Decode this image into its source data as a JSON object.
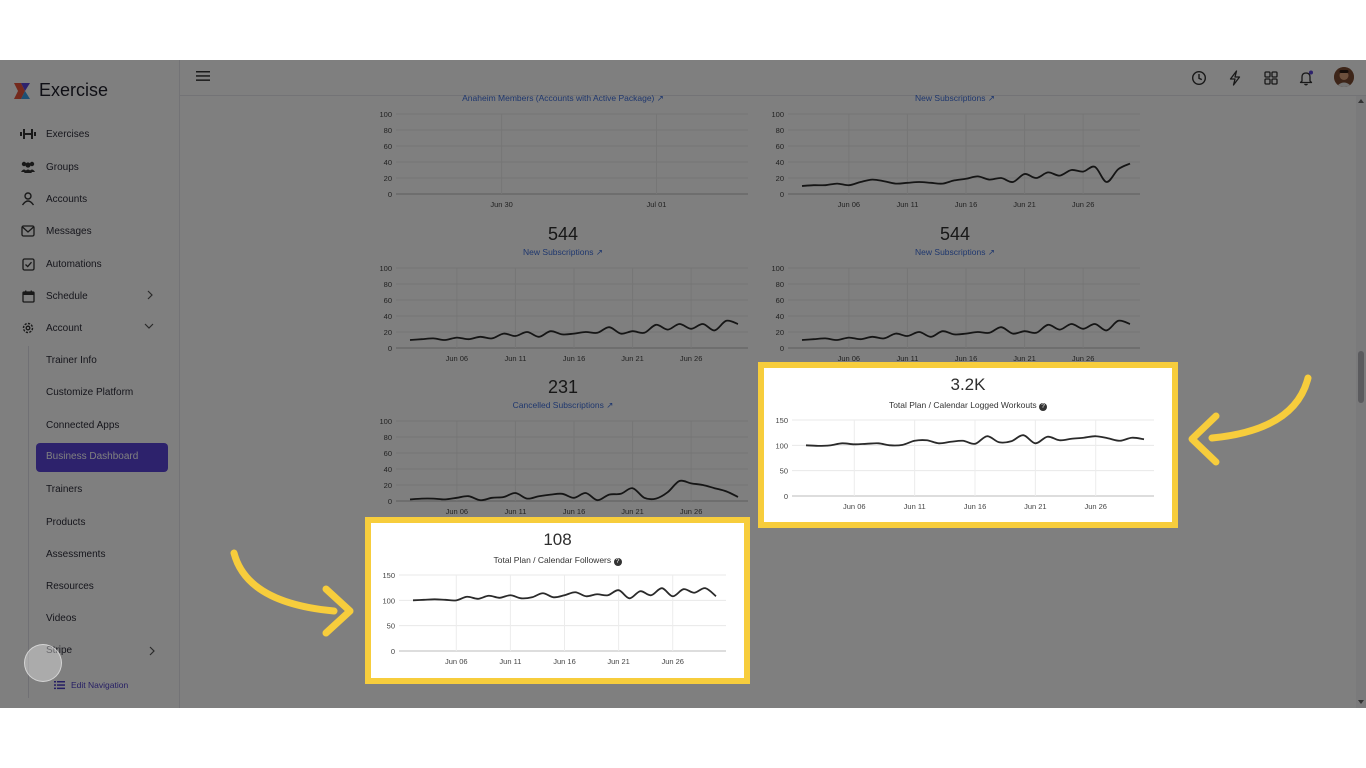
{
  "app": {
    "brand": "Exercise"
  },
  "sidebar": {
    "items": [
      {
        "label": "Exercises",
        "icon": "dumbbell-icon"
      },
      {
        "label": "Groups",
        "icon": "users-icon"
      },
      {
        "label": "Accounts",
        "icon": "user-icon"
      },
      {
        "label": "Messages",
        "icon": "mail-icon"
      },
      {
        "label": "Automations",
        "icon": "checkbox-icon"
      },
      {
        "label": "Schedule",
        "icon": "calendar-icon"
      },
      {
        "label": "Account",
        "icon": "gear-icon"
      }
    ],
    "subitems": [
      "Trainer Info",
      "Customize Platform",
      "Connected Apps",
      "Business Dashboard",
      "Trainers",
      "Products",
      "Assessments",
      "Resources",
      "Videos",
      "Stripe"
    ],
    "active_subitem": "Business Dashboard",
    "edit_navigation": "Edit Navigation"
  },
  "colors": {
    "accent": "#5b45d9",
    "link": "#3e6fdc",
    "highlight": "#f7cd3c",
    "line": "#2a2a2a"
  },
  "chart_data": [
    {
      "type": "line",
      "title": "Anaheim Members (Accounts with Active Package)",
      "categories": [
        "Jun 30",
        "Jul 01"
      ],
      "values": [],
      "ylim": [
        0,
        100
      ],
      "yticks": [
        0,
        20,
        40,
        60,
        80,
        100
      ]
    },
    {
      "type": "line",
      "title": "New Subscriptions",
      "categories": [
        "Jun 06",
        "Jun 11",
        "Jun 16",
        "Jun 21",
        "Jun 26"
      ],
      "x": [
        1,
        2,
        3,
        4,
        5,
        6,
        7,
        8,
        9,
        10,
        11,
        12,
        13,
        14,
        15,
        16,
        17,
        18,
        19,
        20,
        21,
        22,
        23,
        24,
        25,
        26,
        27,
        28,
        29
      ],
      "values": [
        10,
        11,
        11,
        13,
        11,
        15,
        18,
        16,
        13,
        14,
        15,
        14,
        13,
        17,
        19,
        22,
        18,
        20,
        15,
        25,
        20,
        27,
        23,
        30,
        28,
        34,
        15,
        31,
        38
      ],
      "ylim": [
        0,
        100
      ],
      "yticks": [
        0,
        20,
        40,
        60,
        80,
        100
      ]
    },
    {
      "type": "line",
      "big_number": "544",
      "title": "New Subscriptions",
      "categories": [
        "Jun 06",
        "Jun 11",
        "Jun 16",
        "Jun 21",
        "Jun 26"
      ],
      "x": [
        1,
        2,
        3,
        4,
        5,
        6,
        7,
        8,
        9,
        10,
        11,
        12,
        13,
        14,
        15,
        16,
        17,
        18,
        19,
        20,
        21,
        22,
        23,
        24,
        25,
        26,
        27,
        28,
        29
      ],
      "values": [
        10,
        11,
        12,
        10,
        13,
        11,
        14,
        12,
        18,
        15,
        20,
        14,
        21,
        17,
        18,
        20,
        19,
        26,
        18,
        21,
        19,
        29,
        23,
        30,
        24,
        30,
        22,
        34,
        30
      ],
      "ylim": [
        0,
        100
      ],
      "yticks": [
        0,
        20,
        40,
        60,
        80,
        100
      ]
    },
    {
      "type": "line",
      "big_number": "544",
      "title": "New Subscriptions",
      "categories": [
        "Jun 06",
        "Jun 11",
        "Jun 16",
        "Jun 21",
        "Jun 26"
      ],
      "x": [
        1,
        2,
        3,
        4,
        5,
        6,
        7,
        8,
        9,
        10,
        11,
        12,
        13,
        14,
        15,
        16,
        17,
        18,
        19,
        20,
        21,
        22,
        23,
        24,
        25,
        26,
        27,
        28,
        29
      ],
      "values": [
        10,
        11,
        12,
        10,
        13,
        11,
        14,
        12,
        18,
        15,
        20,
        14,
        21,
        17,
        18,
        20,
        19,
        26,
        18,
        21,
        19,
        29,
        23,
        30,
        24,
        30,
        22,
        34,
        30
      ],
      "ylim": [
        0,
        100
      ],
      "yticks": [
        0,
        20,
        40,
        60,
        80,
        100
      ]
    },
    {
      "type": "line",
      "big_number": "231",
      "title": "Cancelled Subscriptions",
      "categories": [
        "Jun 06",
        "Jun 11",
        "Jun 16",
        "Jun 21",
        "Jun 26"
      ],
      "x": [
        1,
        2,
        3,
        4,
        5,
        6,
        7,
        8,
        9,
        10,
        11,
        12,
        13,
        14,
        15,
        16,
        17,
        18,
        19,
        20,
        21,
        22,
        23,
        24,
        25,
        26,
        27,
        28,
        29
      ],
      "values": [
        2,
        3,
        3,
        2,
        4,
        6,
        1,
        4,
        5,
        10,
        3,
        6,
        8,
        9,
        4,
        10,
        1,
        8,
        9,
        16,
        4,
        3,
        11,
        25,
        22,
        20,
        16,
        12,
        5
      ],
      "ylim": [
        0,
        100
      ],
      "yticks": [
        0,
        20,
        40,
        60,
        80,
        100
      ]
    },
    {
      "type": "line",
      "big_number": "3.2K",
      "title": "Total Plan / Calendar Logged Workouts",
      "categories": [
        "Jun 06",
        "Jun 11",
        "Jun 16",
        "Jun 21",
        "Jun 26"
      ],
      "x": [
        1,
        2,
        3,
        4,
        5,
        6,
        7,
        8,
        9,
        10,
        11,
        12,
        13,
        14,
        15,
        16,
        17,
        18,
        19,
        20,
        21,
        22,
        23,
        24,
        25,
        26,
        27,
        28,
        29
      ],
      "values": [
        100,
        99,
        100,
        104,
        102,
        103,
        104,
        100,
        101,
        109,
        110,
        104,
        107,
        109,
        103,
        118,
        106,
        108,
        120,
        104,
        117,
        110,
        113,
        115,
        118,
        114,
        109,
        115,
        112
      ],
      "ylim": [
        0,
        150
      ],
      "yticks": [
        0,
        50,
        100,
        150
      ]
    },
    {
      "type": "line",
      "big_number": "108",
      "title": "Total Plan / Calendar Followers",
      "categories": [
        "Jun 06",
        "Jun 11",
        "Jun 16",
        "Jun 21",
        "Jun 26"
      ],
      "x": [
        1,
        2,
        3,
        4,
        5,
        6,
        7,
        8,
        9,
        10,
        11,
        12,
        13,
        14,
        15,
        16,
        17,
        18,
        19,
        20,
        21,
        22,
        23,
        24,
        25,
        26,
        27,
        28,
        29
      ],
      "values": [
        100,
        101,
        102,
        101,
        100,
        107,
        103,
        109,
        105,
        110,
        104,
        106,
        114,
        106,
        110,
        116,
        108,
        112,
        110,
        120,
        104,
        118,
        110,
        124,
        108,
        122,
        115,
        124,
        108
      ],
      "ylim": [
        0,
        150
      ],
      "yticks": [
        0,
        50,
        100,
        150
      ]
    }
  ]
}
